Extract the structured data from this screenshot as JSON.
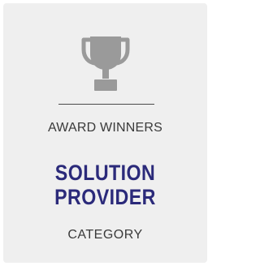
{
  "card": {
    "icon": "trophy-icon",
    "award_label": "AWARD WINNERS",
    "title_line1": "SOLUTION",
    "title_line2": "PROVIDER",
    "category": "CATEGORY"
  },
  "colors": {
    "background": "#efefef",
    "title": "#2b2a7a",
    "text": "#3a3a3a",
    "icon": "#9a9a9a"
  }
}
